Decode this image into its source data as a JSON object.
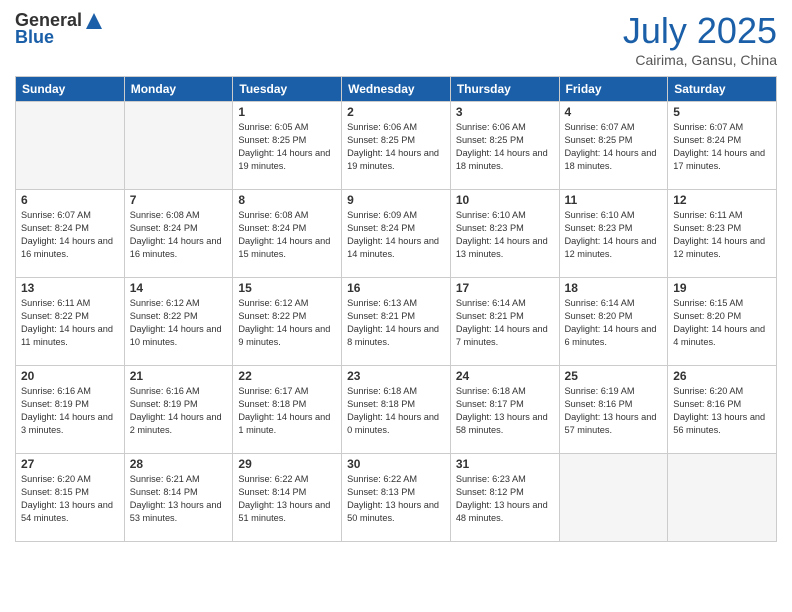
{
  "header": {
    "logo_general": "General",
    "logo_blue": "Blue",
    "month_year": "July 2025",
    "location": "Cairima, Gansu, China"
  },
  "days_of_week": [
    "Sunday",
    "Monday",
    "Tuesday",
    "Wednesday",
    "Thursday",
    "Friday",
    "Saturday"
  ],
  "weeks": [
    [
      {
        "day": "",
        "info": ""
      },
      {
        "day": "",
        "info": ""
      },
      {
        "day": "1",
        "info": "Sunrise: 6:05 AM\nSunset: 8:25 PM\nDaylight: 14 hours and 19 minutes."
      },
      {
        "day": "2",
        "info": "Sunrise: 6:06 AM\nSunset: 8:25 PM\nDaylight: 14 hours and 19 minutes."
      },
      {
        "day": "3",
        "info": "Sunrise: 6:06 AM\nSunset: 8:25 PM\nDaylight: 14 hours and 18 minutes."
      },
      {
        "day": "4",
        "info": "Sunrise: 6:07 AM\nSunset: 8:25 PM\nDaylight: 14 hours and 18 minutes."
      },
      {
        "day": "5",
        "info": "Sunrise: 6:07 AM\nSunset: 8:24 PM\nDaylight: 14 hours and 17 minutes."
      }
    ],
    [
      {
        "day": "6",
        "info": "Sunrise: 6:07 AM\nSunset: 8:24 PM\nDaylight: 14 hours and 16 minutes."
      },
      {
        "day": "7",
        "info": "Sunrise: 6:08 AM\nSunset: 8:24 PM\nDaylight: 14 hours and 16 minutes."
      },
      {
        "day": "8",
        "info": "Sunrise: 6:08 AM\nSunset: 8:24 PM\nDaylight: 14 hours and 15 minutes."
      },
      {
        "day": "9",
        "info": "Sunrise: 6:09 AM\nSunset: 8:24 PM\nDaylight: 14 hours and 14 minutes."
      },
      {
        "day": "10",
        "info": "Sunrise: 6:10 AM\nSunset: 8:23 PM\nDaylight: 14 hours and 13 minutes."
      },
      {
        "day": "11",
        "info": "Sunrise: 6:10 AM\nSunset: 8:23 PM\nDaylight: 14 hours and 12 minutes."
      },
      {
        "day": "12",
        "info": "Sunrise: 6:11 AM\nSunset: 8:23 PM\nDaylight: 14 hours and 12 minutes."
      }
    ],
    [
      {
        "day": "13",
        "info": "Sunrise: 6:11 AM\nSunset: 8:22 PM\nDaylight: 14 hours and 11 minutes."
      },
      {
        "day": "14",
        "info": "Sunrise: 6:12 AM\nSunset: 8:22 PM\nDaylight: 14 hours and 10 minutes."
      },
      {
        "day": "15",
        "info": "Sunrise: 6:12 AM\nSunset: 8:22 PM\nDaylight: 14 hours and 9 minutes."
      },
      {
        "day": "16",
        "info": "Sunrise: 6:13 AM\nSunset: 8:21 PM\nDaylight: 14 hours and 8 minutes."
      },
      {
        "day": "17",
        "info": "Sunrise: 6:14 AM\nSunset: 8:21 PM\nDaylight: 14 hours and 7 minutes."
      },
      {
        "day": "18",
        "info": "Sunrise: 6:14 AM\nSunset: 8:20 PM\nDaylight: 14 hours and 6 minutes."
      },
      {
        "day": "19",
        "info": "Sunrise: 6:15 AM\nSunset: 8:20 PM\nDaylight: 14 hours and 4 minutes."
      }
    ],
    [
      {
        "day": "20",
        "info": "Sunrise: 6:16 AM\nSunset: 8:19 PM\nDaylight: 14 hours and 3 minutes."
      },
      {
        "day": "21",
        "info": "Sunrise: 6:16 AM\nSunset: 8:19 PM\nDaylight: 14 hours and 2 minutes."
      },
      {
        "day": "22",
        "info": "Sunrise: 6:17 AM\nSunset: 8:18 PM\nDaylight: 14 hours and 1 minute."
      },
      {
        "day": "23",
        "info": "Sunrise: 6:18 AM\nSunset: 8:18 PM\nDaylight: 14 hours and 0 minutes."
      },
      {
        "day": "24",
        "info": "Sunrise: 6:18 AM\nSunset: 8:17 PM\nDaylight: 13 hours and 58 minutes."
      },
      {
        "day": "25",
        "info": "Sunrise: 6:19 AM\nSunset: 8:16 PM\nDaylight: 13 hours and 57 minutes."
      },
      {
        "day": "26",
        "info": "Sunrise: 6:20 AM\nSunset: 8:16 PM\nDaylight: 13 hours and 56 minutes."
      }
    ],
    [
      {
        "day": "27",
        "info": "Sunrise: 6:20 AM\nSunset: 8:15 PM\nDaylight: 13 hours and 54 minutes."
      },
      {
        "day": "28",
        "info": "Sunrise: 6:21 AM\nSunset: 8:14 PM\nDaylight: 13 hours and 53 minutes."
      },
      {
        "day": "29",
        "info": "Sunrise: 6:22 AM\nSunset: 8:14 PM\nDaylight: 13 hours and 51 minutes."
      },
      {
        "day": "30",
        "info": "Sunrise: 6:22 AM\nSunset: 8:13 PM\nDaylight: 13 hours and 50 minutes."
      },
      {
        "day": "31",
        "info": "Sunrise: 6:23 AM\nSunset: 8:12 PM\nDaylight: 13 hours and 48 minutes."
      },
      {
        "day": "",
        "info": ""
      },
      {
        "day": "",
        "info": ""
      }
    ]
  ]
}
